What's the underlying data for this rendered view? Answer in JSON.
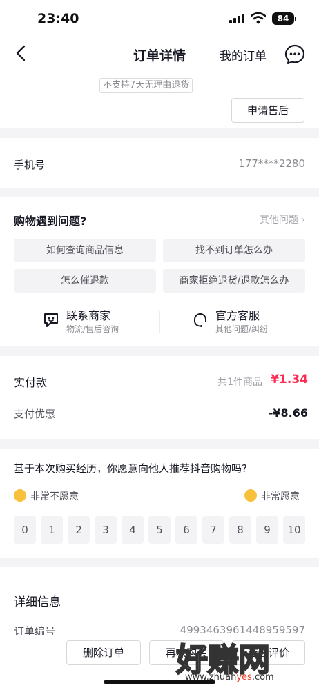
{
  "status": {
    "time": "23:40",
    "battery": "84"
  },
  "nav": {
    "title": "订单详情",
    "my_orders": "我的订单"
  },
  "top": {
    "return_tag": "不支持7天无理由退货",
    "after_sale": "申请售后"
  },
  "phone": {
    "label": "手机号",
    "value": "177****2280"
  },
  "problems": {
    "title": "购物遇到问题?",
    "other": "其他问题 ›",
    "chips": [
      "如何查询商品信息",
      "找不到订单怎么办",
      "怎么催退款",
      "商家拒绝退货/退款怎么办"
    ],
    "contact_merchant": {
      "title": "联系商家",
      "sub": "物流/售后咨询"
    },
    "official_service": {
      "title": "官方客服",
      "sub": "其他问题/纠纷"
    }
  },
  "payment": {
    "paid_label": "实付款",
    "count": "共1件商品",
    "paid_amount": "¥1.34",
    "discount_label": "支付优惠",
    "discount_amount": "-¥8.66"
  },
  "survey": {
    "question": "基于本次购买经历，你愿意向他人推荐抖音购物吗?",
    "low_label": "非常不愿意",
    "high_label": "非常愿意",
    "scores": [
      "0",
      "1",
      "2",
      "3",
      "4",
      "5",
      "6",
      "7",
      "8",
      "9",
      "10"
    ]
  },
  "details": {
    "title": "详细信息",
    "order_no_label": "订单编号",
    "order_no": "4993463961448959597"
  },
  "bottom": {
    "delete_order": "删除订单",
    "rebuy": "再次购买",
    "review": "查看评价"
  },
  "watermark": {
    "text": "好赚网",
    "url_prefix": "www.zhuan",
    "url_accent": "yes",
    "url_suffix": ".com"
  },
  "colors": {
    "accent": "#fe2c55",
    "text": "#161823",
    "muted": "#8a8b91",
    "bg": "#f4f4f6"
  }
}
